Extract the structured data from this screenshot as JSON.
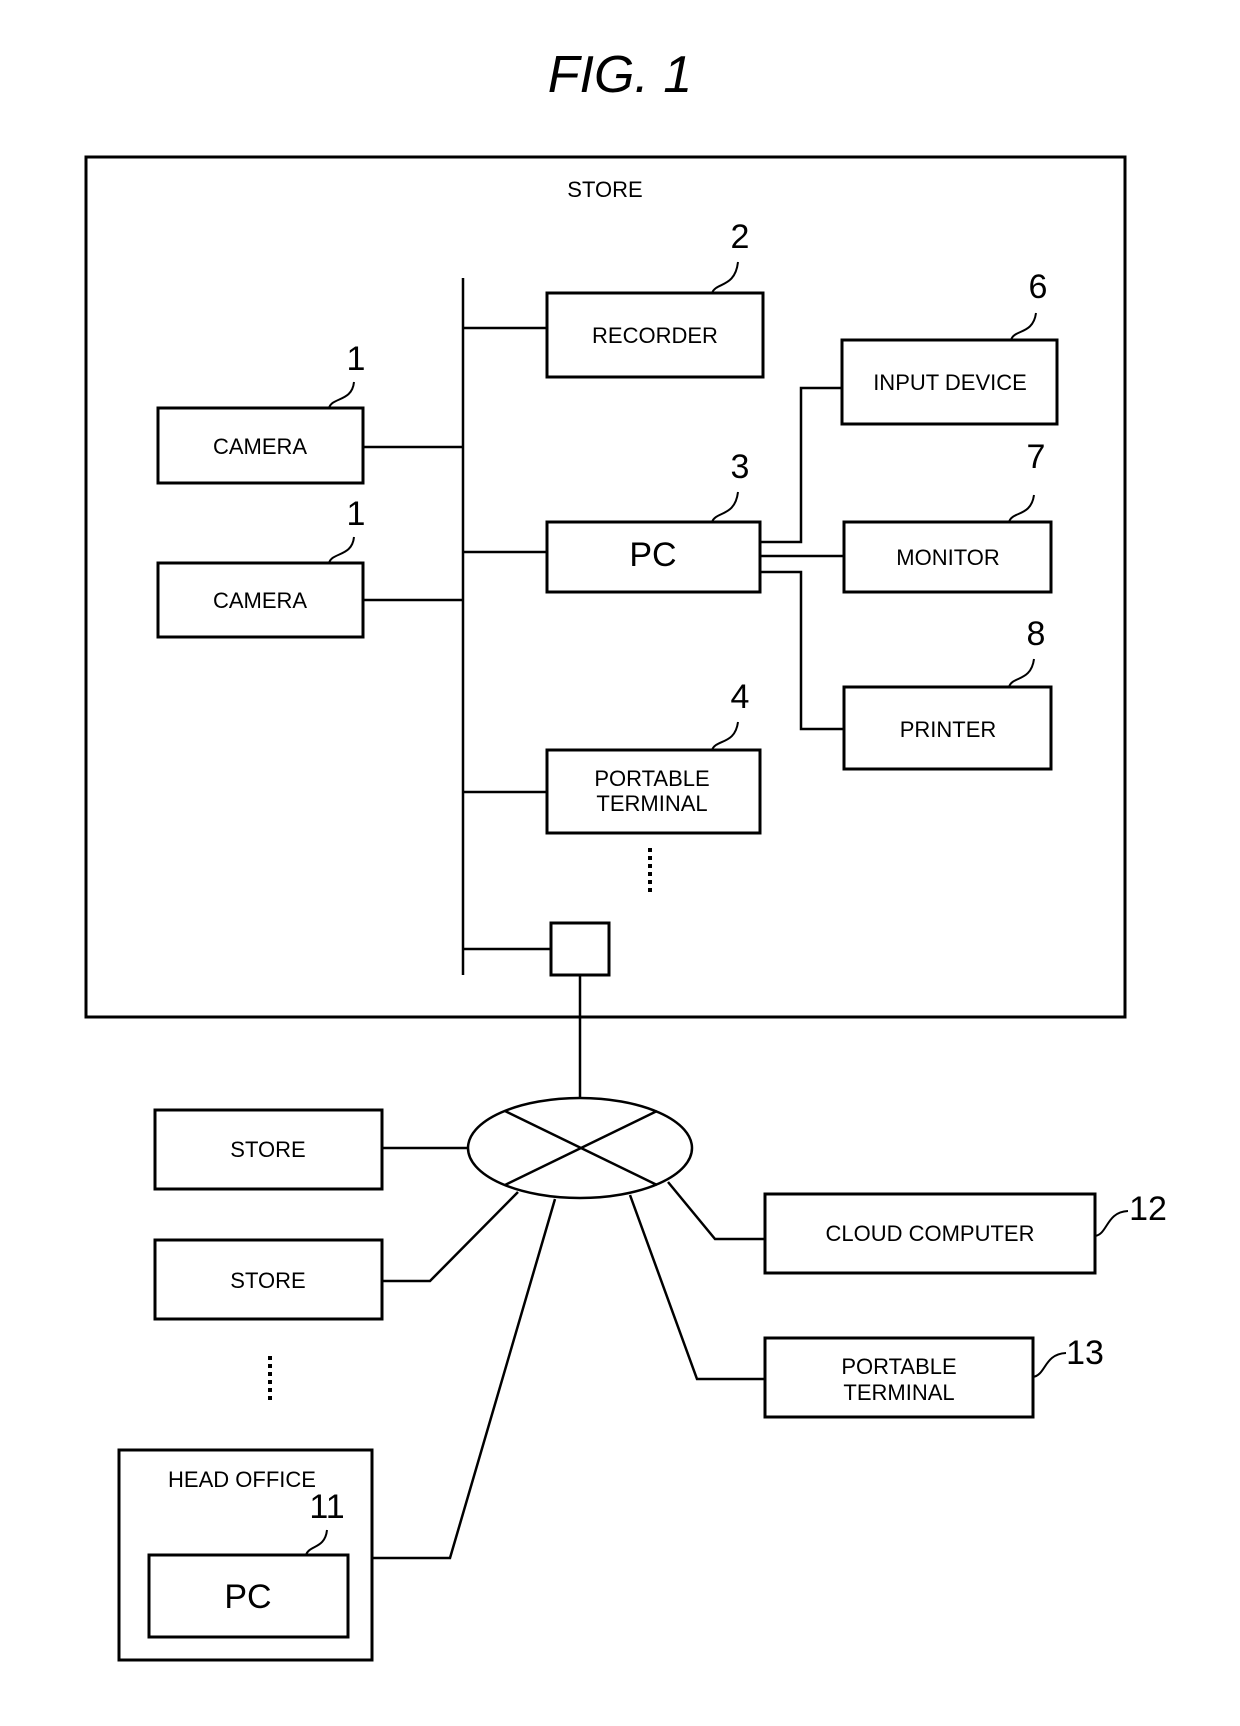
{
  "figure": {
    "title": "FIG. 1",
    "store_label": "STORE"
  },
  "store": {
    "cameras": [
      {
        "label": "CAMERA",
        "ref": "1"
      },
      {
        "label": "CAMERA",
        "ref": "1"
      }
    ],
    "recorder": {
      "label": "RECORDER",
      "ref": "2"
    },
    "pc": {
      "label": "PC",
      "ref": "3"
    },
    "portable_terminal": {
      "label_line1": "PORTABLE",
      "label_line2": "TERMINAL",
      "ref": "4"
    },
    "input_device": {
      "label": "INPUT DEVICE",
      "ref": "6"
    },
    "monitor": {
      "label": "MONITOR",
      "ref": "7"
    },
    "printer": {
      "label": "PRINTER",
      "ref": "8"
    }
  },
  "network": {
    "other_stores": [
      {
        "label": "STORE"
      },
      {
        "label": "STORE"
      }
    ],
    "head_office": {
      "label": "HEAD OFFICE",
      "pc_label": "PC",
      "ref": "11"
    },
    "cloud_computer": {
      "label": "CLOUD COMPUTER",
      "ref": "12"
    },
    "remote_portable_terminal": {
      "label_line1": "PORTABLE",
      "label_line2": "TERMINAL",
      "ref": "13"
    }
  }
}
